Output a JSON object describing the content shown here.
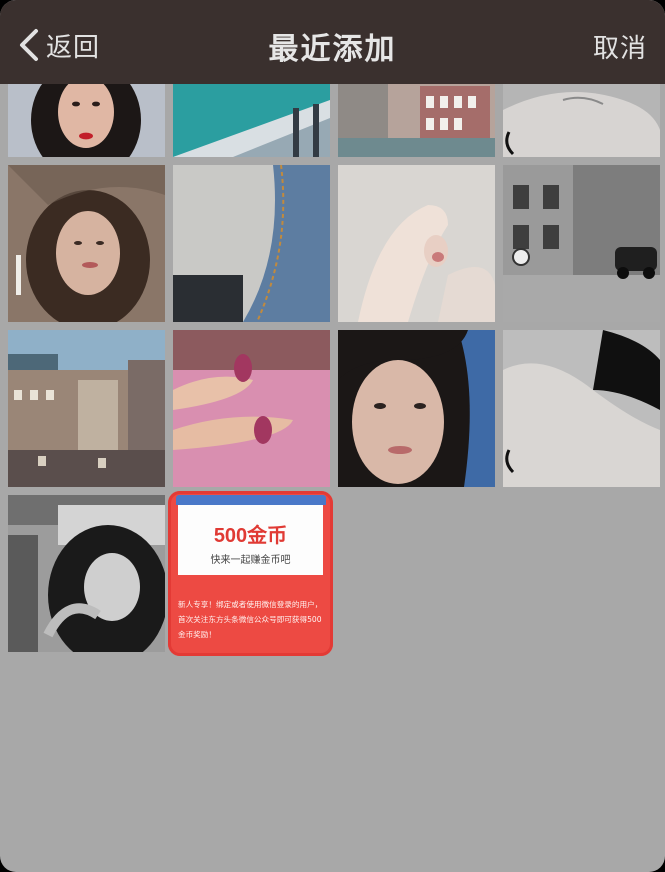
{
  "header": {
    "back_label": "返回",
    "title": "最近添加",
    "cancel_label": "取消"
  },
  "photos": [
    {
      "name": "photo-woman-red-lips"
    },
    {
      "name": "photo-teal-building"
    },
    {
      "name": "photo-venice-canal"
    },
    {
      "name": "photo-shoulder-bw-top"
    },
    {
      "name": "photo-woman-cigarette"
    },
    {
      "name": "photo-denim-pocket"
    },
    {
      "name": "photo-fingers"
    },
    {
      "name": "photo-street-bw"
    },
    {
      "name": "photo-city-rooftops"
    },
    {
      "name": "photo-feet-pink"
    },
    {
      "name": "photo-woman-blue-bg"
    },
    {
      "name": "photo-shoulder-bw"
    },
    {
      "name": "photo-girl-window-bw"
    }
  ],
  "promo": {
    "amount": "500金币",
    "subtitle": "快来一起赚金币吧",
    "description": "新人专享！绑定或者使用微信登录的用户，首次关注东方头条微信公众号即可获得500金币奖励！",
    "accent_color": "#ed4a43"
  },
  "colors": {
    "header_bg": "#3a302e",
    "grid_bg": "#a8a8a8"
  }
}
